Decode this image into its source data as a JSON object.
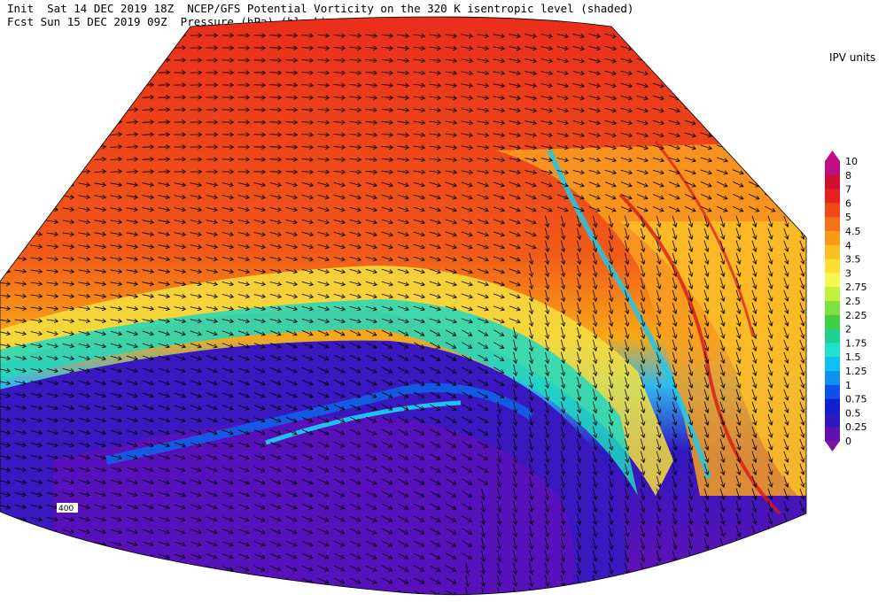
{
  "header": {
    "line1": "Init  Sat 14 DEC 2019 18Z  NCEP/GFS Potential Vorticity on the 320 K isentropic level (shaded)",
    "line2": "Fcst Sun 15 DEC 2019 09Z  Pressure (hPa) (black)."
  },
  "legend": {
    "units": "IPV units",
    "levels": [
      "10",
      "8",
      "7",
      "6",
      "5",
      "4.5",
      "4",
      "3.5",
      "3",
      "2.75",
      "2.5",
      "2.25",
      "2",
      "1.75",
      "1.5",
      "1.25",
      "1",
      "0.75",
      "0.5",
      "0.25",
      "0"
    ],
    "colors": [
      "#c01080",
      "#d01030",
      "#e82020",
      "#f04818",
      "#f87018",
      "#fa9a18",
      "#fcc020",
      "#fde030",
      "#f4f850",
      "#c0f040",
      "#80e040",
      "#40d040",
      "#20d090",
      "#20e0d0",
      "#10c0f0",
      "#1090f0",
      "#1050e8",
      "#1020d0",
      "#3018c0",
      "#6010b0",
      "#8010a0"
    ]
  },
  "map_labels": {
    "pressure_label": "400"
  }
}
